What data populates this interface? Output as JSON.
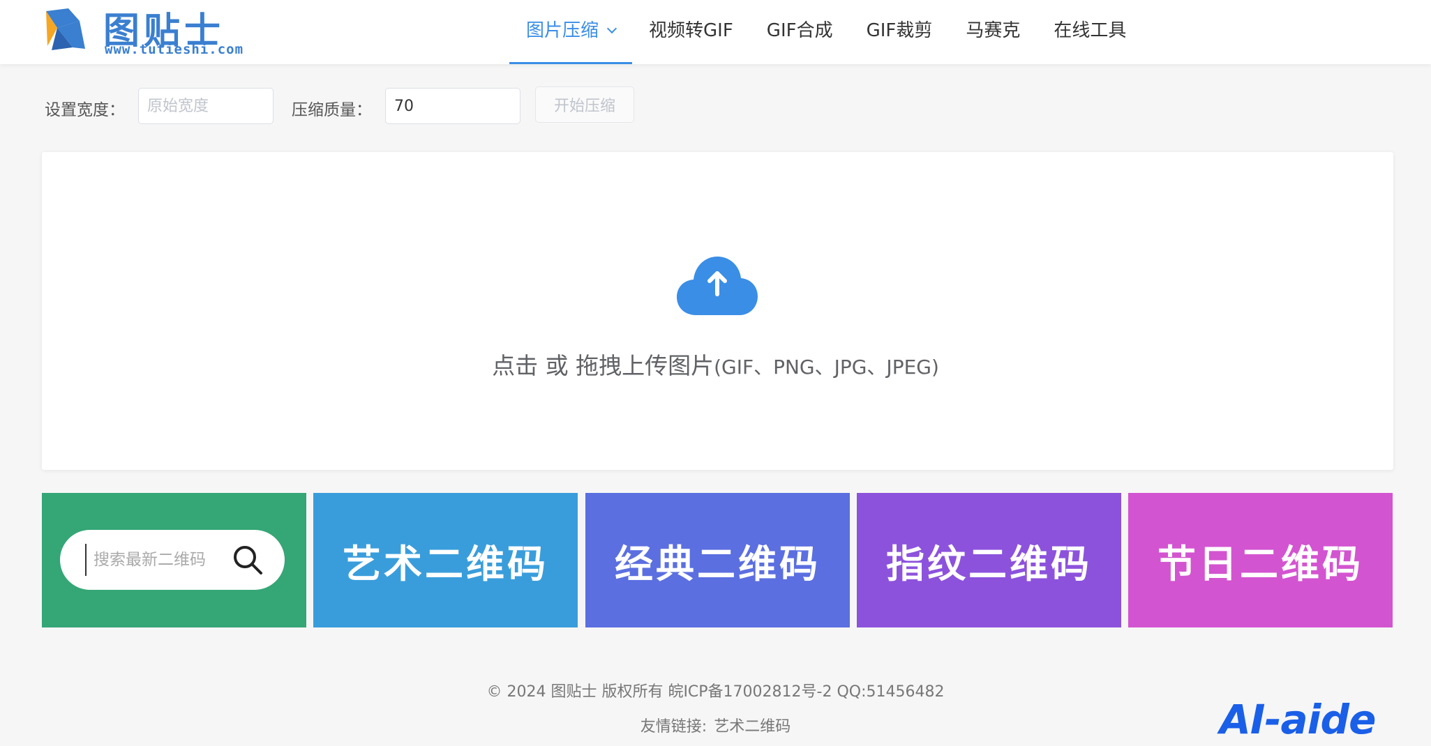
{
  "logo": {
    "title": "图贴士",
    "subtitle": "www.tutieshi.com"
  },
  "nav": {
    "items": [
      {
        "label": "图片压缩",
        "active": true,
        "has_dropdown": true
      },
      {
        "label": "视频转GIF"
      },
      {
        "label": "GIF合成"
      },
      {
        "label": "GIF裁剪"
      },
      {
        "label": "马赛克"
      },
      {
        "label": "在线工具"
      }
    ]
  },
  "settings": {
    "width_label": "设置宽度：",
    "width_placeholder": "原始宽度",
    "width_value": "",
    "quality_label": "压缩质量：",
    "quality_value": "70",
    "start_label": "开始压缩"
  },
  "upload": {
    "icon": "cloud-upload-icon",
    "text": "点击 或 拖拽上传图片",
    "formats": "(GIF、PNG、JPG、JPEG)"
  },
  "tiles": {
    "search_placeholder": "搜索最新二维码",
    "items": [
      "艺术二维码",
      "经典二维码",
      "指纹二维码",
      "节日二维码"
    ],
    "colors": [
      "#35a676",
      "#3a9ddb",
      "#5b6fe0",
      "#8c52dc",
      "#d354d0"
    ]
  },
  "footer": {
    "copyright": "© 2024 图贴士 版权所有 皖ICP备17002812号-2 QQ:51456482",
    "links_label": "友情链接:",
    "link_1": "艺术二维码"
  },
  "watermark": "AI-aide",
  "colors": {
    "accent": "#3a8ee6",
    "logo": "#3a7fd0"
  }
}
